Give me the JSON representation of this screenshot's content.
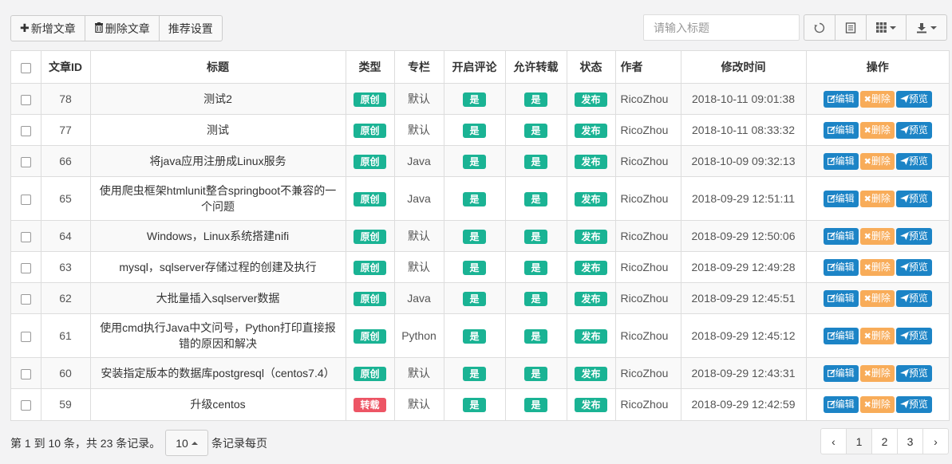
{
  "toolbar": {
    "add_label": "新增文章",
    "delete_label": "删除文章",
    "recommend_label": "推荐设置"
  },
  "search": {
    "placeholder": "请输入标题"
  },
  "icons": [
    "refresh-icon",
    "list-icon",
    "grid-icon",
    "download-icon",
    "plus-icon",
    "trash-icon",
    "edit-icon",
    "close-icon",
    "send-icon"
  ],
  "colors": {
    "green": "#1ab394",
    "red": "#ed5565",
    "blue": "#1c84c6",
    "orange": "#f8ac59"
  },
  "table": {
    "headers": {
      "id": "文章ID",
      "title": "标题",
      "type": "类型",
      "column": "专栏",
      "comment": "开启评论",
      "repost": "允许转载",
      "status": "状态",
      "author": "作者",
      "modified": "修改时间",
      "actions": "操作"
    },
    "action_labels": {
      "edit": "编辑",
      "delete": "删除",
      "preview": "预览"
    },
    "rows": [
      {
        "id": "78",
        "title": "测试2",
        "type": "原创",
        "type_color": "green",
        "column": "默认",
        "comment": "是",
        "repost": "是",
        "status": "发布",
        "author": "RicoZhou",
        "modified": "2018-10-11 09:01:38"
      },
      {
        "id": "77",
        "title": "测试",
        "type": "原创",
        "type_color": "green",
        "column": "默认",
        "comment": "是",
        "repost": "是",
        "status": "发布",
        "author": "RicoZhou",
        "modified": "2018-10-11 08:33:32"
      },
      {
        "id": "66",
        "title": "将java应用注册成Linux服务",
        "type": "原创",
        "type_color": "green",
        "column": "Java",
        "comment": "是",
        "repost": "是",
        "status": "发布",
        "author": "RicoZhou",
        "modified": "2018-10-09 09:32:13"
      },
      {
        "id": "65",
        "title": "使用爬虫框架htmlunit整合springboot不兼容的一个问题",
        "type": "原创",
        "type_color": "green",
        "column": "Java",
        "comment": "是",
        "repost": "是",
        "status": "发布",
        "author": "RicoZhou",
        "modified": "2018-09-29 12:51:11"
      },
      {
        "id": "64",
        "title": "Windows，Linux系统搭建nifi",
        "type": "原创",
        "type_color": "green",
        "column": "默认",
        "comment": "是",
        "repost": "是",
        "status": "发布",
        "author": "RicoZhou",
        "modified": "2018-09-29 12:50:06"
      },
      {
        "id": "63",
        "title": "mysql，sqlserver存储过程的创建及执行",
        "type": "原创",
        "type_color": "green",
        "column": "默认",
        "comment": "是",
        "repost": "是",
        "status": "发布",
        "author": "RicoZhou",
        "modified": "2018-09-29 12:49:28"
      },
      {
        "id": "62",
        "title": "大批量插入sqlserver数据",
        "type": "原创",
        "type_color": "green",
        "column": "Java",
        "comment": "是",
        "repost": "是",
        "status": "发布",
        "author": "RicoZhou",
        "modified": "2018-09-29 12:45:51"
      },
      {
        "id": "61",
        "title": "使用cmd执行Java中文问号，Python打印直接报错的原因和解决",
        "type": "原创",
        "type_color": "green",
        "column": "Python",
        "comment": "是",
        "repost": "是",
        "status": "发布",
        "author": "RicoZhou",
        "modified": "2018-09-29 12:45:12"
      },
      {
        "id": "60",
        "title": "安装指定版本的数据库postgresql（centos7.4）",
        "type": "原创",
        "type_color": "green",
        "column": "默认",
        "comment": "是",
        "repost": "是",
        "status": "发布",
        "author": "RicoZhou",
        "modified": "2018-09-29 12:43:31"
      },
      {
        "id": "59",
        "title": "升级centos",
        "type": "转载",
        "type_color": "red",
        "column": "默认",
        "comment": "是",
        "repost": "是",
        "status": "发布",
        "author": "RicoZhou",
        "modified": "2018-09-29 12:42:59"
      }
    ]
  },
  "pagination": {
    "info": "第 1 到 10 条，共 23 条记录。",
    "page_size": "10",
    "page_size_suffix": "条记录每页",
    "prev": "‹",
    "next": "›",
    "pages": [
      "1",
      "2",
      "3"
    ]
  }
}
